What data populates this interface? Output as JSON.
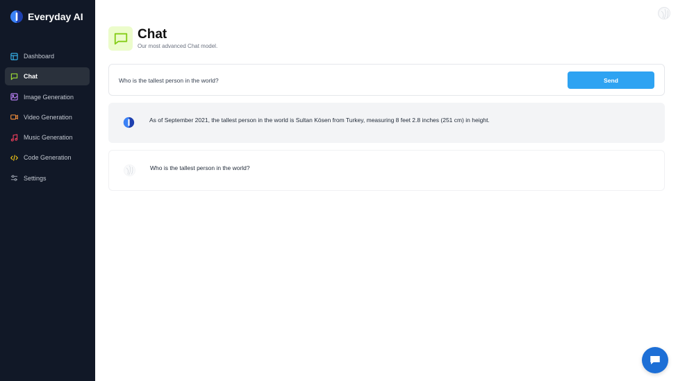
{
  "app": {
    "name": "Everyday AI"
  },
  "sidebar": {
    "items": [
      {
        "label": "Dashboard",
        "icon": "layout-icon",
        "color": "#38bdf8",
        "active": false
      },
      {
        "label": "Chat",
        "icon": "chat-icon",
        "color": "#a3e635",
        "active": true
      },
      {
        "label": "Image Generation",
        "icon": "image-icon",
        "color": "#c084fc",
        "active": false
      },
      {
        "label": "Video Generation",
        "icon": "video-icon",
        "color": "#fb923c",
        "active": false
      },
      {
        "label": "Music Generation",
        "icon": "music-icon",
        "color": "#f43f5e",
        "active": false
      },
      {
        "label": "Code Generation",
        "icon": "code-icon",
        "color": "#facc15",
        "active": false
      },
      {
        "label": "Settings",
        "icon": "settings-icon",
        "color": "#9ca3af",
        "active": false
      }
    ]
  },
  "header": {
    "title": "Chat",
    "subtitle": "Our most advanced Chat model.",
    "icon": "chat-icon",
    "icon_color": "#84cc16"
  },
  "prompt": {
    "value": "Who is the tallest person in the world?",
    "send_label": "Send",
    "send_color": "#2ea3f2"
  },
  "messages": [
    {
      "role": "assistant",
      "avatar": "everyday-ai-logo-icon",
      "text": "As of September 2021, the tallest person in the world is Sultan Kösen from Turkey, measuring 8 feet 2.8 inches (251 cm) in height."
    },
    {
      "role": "user",
      "avatar": "user-avatar-icon",
      "text": "Who is the tallest person in the world?"
    }
  ],
  "colors": {
    "sidebar_bg": "#111827",
    "accent": "#2ea3f2",
    "fab": "#1d6fd6"
  }
}
